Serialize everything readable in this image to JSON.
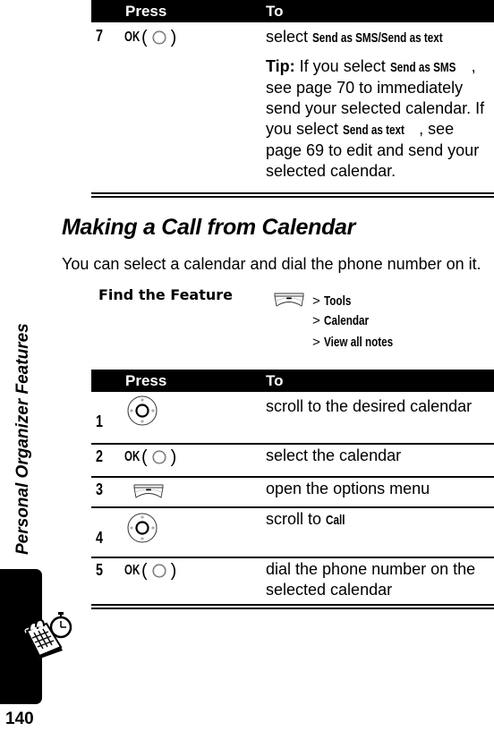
{
  "sidebar": {
    "section_label": "Personal Organizer Features",
    "icon": "organizer-calendar-clock-icon",
    "page_number": "140"
  },
  "table_top": {
    "header": {
      "press": "Press",
      "to": "To"
    },
    "rows": [
      {
        "step": "7",
        "press": {
          "type": "ok-key",
          "label": "OK",
          "icon": "center-select-key-icon"
        },
        "to": {
          "parts": [
            "select ",
            "Send as SMS/Send as text"
          ],
          "tip": {
            "label": "Tip:",
            "t1": " If you select ",
            "k1": "Send as SMS",
            "t2": ", see page 70 to immediately send your selected calendar. If you select ",
            "k2": "Send as text",
            "t3": ", see page 69 to edit and send your selected calendar."
          }
        }
      }
    ]
  },
  "section": {
    "heading": "Making a Call from Calendar",
    "intro": "You can select a calendar and dial the phone number on it."
  },
  "find_feature": {
    "label": "Find the Feature",
    "icon": "menu-key-icon",
    "path": [
      {
        "sep": ">",
        "item": "Tools"
      },
      {
        "sep": ">",
        "item": "Calendar"
      },
      {
        "sep": ">",
        "item": "View all notes"
      }
    ]
  },
  "table_bottom": {
    "header": {
      "press": "Press",
      "to": "To"
    },
    "rows": [
      {
        "step": "1",
        "press": {
          "type": "nav-key",
          "icon": "navigation-key-icon"
        },
        "to": "scroll to the desired calendar"
      },
      {
        "step": "2",
        "press": {
          "type": "ok-key",
          "label": "OK",
          "icon": "center-select-key-icon"
        },
        "to": "select the calendar"
      },
      {
        "step": "3",
        "press": {
          "type": "menu-key",
          "icon": "menu-key-icon"
        },
        "to": "open the options menu"
      },
      {
        "step": "4",
        "press": {
          "type": "nav-key",
          "icon": "navigation-key-icon"
        },
        "to_prefix": "scroll to ",
        "to_keyword": "Call"
      },
      {
        "step": "5",
        "press": {
          "type": "ok-key",
          "label": "OK",
          "icon": "center-select-key-icon"
        },
        "to": "dial the phone number on the selected calendar"
      }
    ]
  }
}
